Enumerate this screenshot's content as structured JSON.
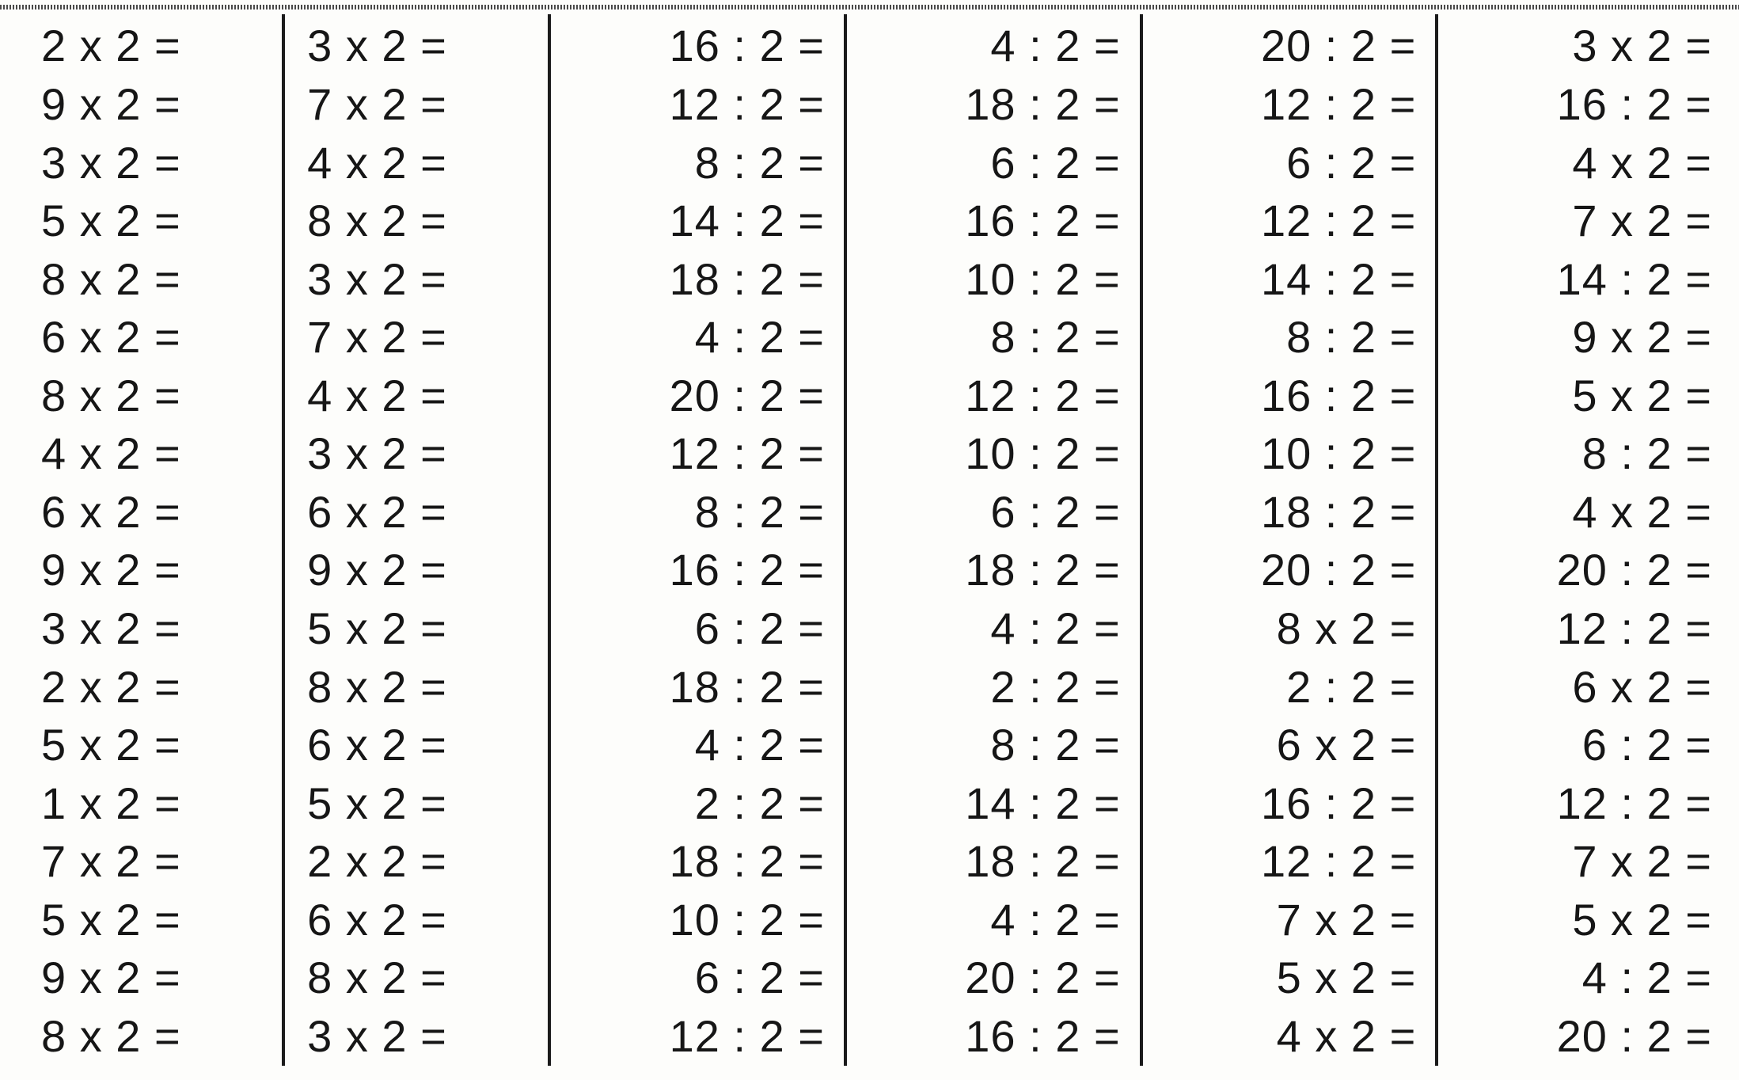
{
  "sheet": {
    "columns": [
      {
        "align": "left",
        "problems": [
          {
            "a": 2,
            "op": "x",
            "b": 2
          },
          {
            "a": 9,
            "op": "x",
            "b": 2
          },
          {
            "a": 3,
            "op": "x",
            "b": 2
          },
          {
            "a": 5,
            "op": "x",
            "b": 2
          },
          {
            "a": 8,
            "op": "x",
            "b": 2
          },
          {
            "a": 6,
            "op": "x",
            "b": 2
          },
          {
            "a": 8,
            "op": "x",
            "b": 2
          },
          {
            "a": 4,
            "op": "x",
            "b": 2
          },
          {
            "a": 6,
            "op": "x",
            "b": 2
          },
          {
            "a": 9,
            "op": "x",
            "b": 2
          },
          {
            "a": 3,
            "op": "x",
            "b": 2
          },
          {
            "a": 2,
            "op": "x",
            "b": 2
          },
          {
            "a": 5,
            "op": "x",
            "b": 2
          },
          {
            "a": 1,
            "op": "x",
            "b": 2
          },
          {
            "a": 7,
            "op": "x",
            "b": 2
          },
          {
            "a": 5,
            "op": "x",
            "b": 2
          },
          {
            "a": 9,
            "op": "x",
            "b": 2
          },
          {
            "a": 8,
            "op": "x",
            "b": 2
          }
        ]
      },
      {
        "align": "left",
        "problems": [
          {
            "a": 3,
            "op": "x",
            "b": 2
          },
          {
            "a": 7,
            "op": "x",
            "b": 2
          },
          {
            "a": 4,
            "op": "x",
            "b": 2
          },
          {
            "a": 8,
            "op": "x",
            "b": 2
          },
          {
            "a": 3,
            "op": "x",
            "b": 2
          },
          {
            "a": 7,
            "op": "x",
            "b": 2
          },
          {
            "a": 4,
            "op": "x",
            "b": 2
          },
          {
            "a": 3,
            "op": "x",
            "b": 2
          },
          {
            "a": 6,
            "op": "x",
            "b": 2
          },
          {
            "a": 9,
            "op": "x",
            "b": 2
          },
          {
            "a": 5,
            "op": "x",
            "b": 2
          },
          {
            "a": 8,
            "op": "x",
            "b": 2
          },
          {
            "a": 6,
            "op": "x",
            "b": 2
          },
          {
            "a": 5,
            "op": "x",
            "b": 2
          },
          {
            "a": 2,
            "op": "x",
            "b": 2
          },
          {
            "a": 6,
            "op": "x",
            "b": 2
          },
          {
            "a": 8,
            "op": "x",
            "b": 2
          },
          {
            "a": 3,
            "op": "x",
            "b": 2
          }
        ]
      },
      {
        "align": "right",
        "problems": [
          {
            "a": 16,
            "op": ":",
            "b": 2
          },
          {
            "a": 12,
            "op": ":",
            "b": 2
          },
          {
            "a": 8,
            "op": ":",
            "b": 2
          },
          {
            "a": 14,
            "op": ":",
            "b": 2
          },
          {
            "a": 18,
            "op": ":",
            "b": 2
          },
          {
            "a": 4,
            "op": ":",
            "b": 2
          },
          {
            "a": 20,
            "op": ":",
            "b": 2
          },
          {
            "a": 12,
            "op": ":",
            "b": 2
          },
          {
            "a": 8,
            "op": ":",
            "b": 2
          },
          {
            "a": 16,
            "op": ":",
            "b": 2
          },
          {
            "a": 6,
            "op": ":",
            "b": 2
          },
          {
            "a": 18,
            "op": ":",
            "b": 2
          },
          {
            "a": 4,
            "op": ":",
            "b": 2
          },
          {
            "a": 2,
            "op": ":",
            "b": 2
          },
          {
            "a": 18,
            "op": ":",
            "b": 2
          },
          {
            "a": 10,
            "op": ":",
            "b": 2
          },
          {
            "a": 6,
            "op": ":",
            "b": 2
          },
          {
            "a": 12,
            "op": ":",
            "b": 2
          }
        ]
      },
      {
        "align": "right",
        "problems": [
          {
            "a": 4,
            "op": ":",
            "b": 2
          },
          {
            "a": 18,
            "op": ":",
            "b": 2
          },
          {
            "a": 6,
            "op": ":",
            "b": 2
          },
          {
            "a": 16,
            "op": ":",
            "b": 2
          },
          {
            "a": 10,
            "op": ":",
            "b": 2
          },
          {
            "a": 8,
            "op": ":",
            "b": 2
          },
          {
            "a": 12,
            "op": ":",
            "b": 2
          },
          {
            "a": 10,
            "op": ":",
            "b": 2
          },
          {
            "a": 6,
            "op": ":",
            "b": 2
          },
          {
            "a": 18,
            "op": ":",
            "b": 2
          },
          {
            "a": 4,
            "op": ":",
            "b": 2
          },
          {
            "a": 2,
            "op": ":",
            "b": 2
          },
          {
            "a": 8,
            "op": ":",
            "b": 2
          },
          {
            "a": 14,
            "op": ":",
            "b": 2
          },
          {
            "a": 18,
            "op": ":",
            "b": 2
          },
          {
            "a": 4,
            "op": ":",
            "b": 2
          },
          {
            "a": 20,
            "op": ":",
            "b": 2
          },
          {
            "a": 16,
            "op": ":",
            "b": 2
          }
        ]
      },
      {
        "align": "right",
        "problems": [
          {
            "a": 20,
            "op": ":",
            "b": 2
          },
          {
            "a": 12,
            "op": ":",
            "b": 2
          },
          {
            "a": 6,
            "op": ":",
            "b": 2
          },
          {
            "a": 12,
            "op": ":",
            "b": 2
          },
          {
            "a": 14,
            "op": ":",
            "b": 2
          },
          {
            "a": 8,
            "op": ":",
            "b": 2
          },
          {
            "a": 16,
            "op": ":",
            "b": 2
          },
          {
            "a": 10,
            "op": ":",
            "b": 2
          },
          {
            "a": 18,
            "op": ":",
            "b": 2
          },
          {
            "a": 20,
            "op": ":",
            "b": 2
          },
          {
            "a": 8,
            "op": "x",
            "b": 2
          },
          {
            "a": 2,
            "op": ":",
            "b": 2
          },
          {
            "a": 6,
            "op": "x",
            "b": 2
          },
          {
            "a": 16,
            "op": ":",
            "b": 2
          },
          {
            "a": 12,
            "op": ":",
            "b": 2
          },
          {
            "a": 7,
            "op": "x",
            "b": 2
          },
          {
            "a": 5,
            "op": "x",
            "b": 2
          },
          {
            "a": 4,
            "op": "x",
            "b": 2
          }
        ]
      },
      {
        "align": "right",
        "problems": [
          {
            "a": 3,
            "op": "x",
            "b": 2
          },
          {
            "a": 16,
            "op": ":",
            "b": 2
          },
          {
            "a": 4,
            "op": "x",
            "b": 2
          },
          {
            "a": 7,
            "op": "x",
            "b": 2
          },
          {
            "a": 14,
            "op": ":",
            "b": 2
          },
          {
            "a": 9,
            "op": "x",
            "b": 2
          },
          {
            "a": 5,
            "op": "x",
            "b": 2
          },
          {
            "a": 8,
            "op": ":",
            "b": 2
          },
          {
            "a": 4,
            "op": "x",
            "b": 2
          },
          {
            "a": 20,
            "op": ":",
            "b": 2
          },
          {
            "a": 12,
            "op": ":",
            "b": 2
          },
          {
            "a": 6,
            "op": "x",
            "b": 2
          },
          {
            "a": 6,
            "op": ":",
            "b": 2
          },
          {
            "a": 12,
            "op": ":",
            "b": 2
          },
          {
            "a": 7,
            "op": "x",
            "b": 2
          },
          {
            "a": 5,
            "op": "x",
            "b": 2
          },
          {
            "a": 4,
            "op": ":",
            "b": 2
          },
          {
            "a": 20,
            "op": ":",
            "b": 2
          }
        ]
      }
    ]
  }
}
